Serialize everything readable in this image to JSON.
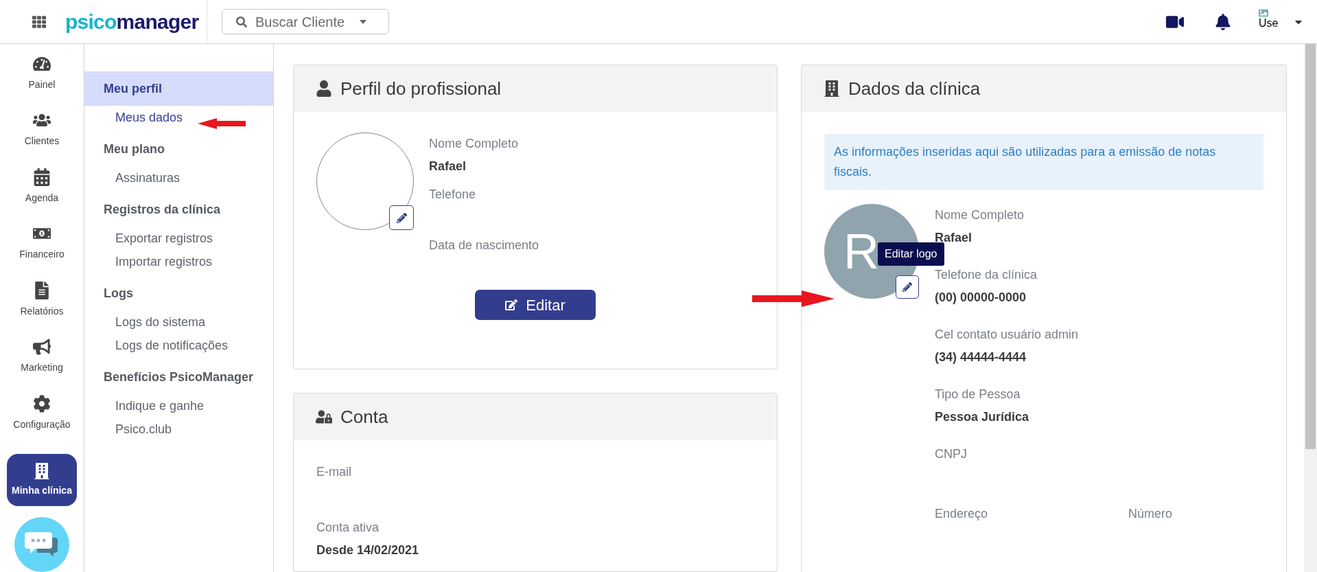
{
  "topbar": {
    "logo_parts": [
      {
        "text": "psico",
        "color": "#12b5c9"
      },
      {
        "text": "manager",
        "color": "#1c1a6b"
      }
    ],
    "search": {
      "placeholder": "Buscar Cliente"
    },
    "avatar_alt": "Use"
  },
  "rail": [
    {
      "label": "Painel",
      "kind": "painel",
      "selected": false
    },
    {
      "label": "Clientes",
      "kind": "clientes",
      "selected": false
    },
    {
      "label": "Agenda",
      "kind": "agenda",
      "selected": false
    },
    {
      "label": "Financeiro",
      "kind": "financeiro",
      "selected": false
    },
    {
      "label": "Relatórios",
      "kind": "relatorios",
      "selected": false
    },
    {
      "label": "Marketing",
      "kind": "marketing",
      "selected": false
    },
    {
      "label": "Configuração",
      "kind": "config",
      "selected": false
    },
    {
      "label": "Minha clínica",
      "kind": "clinica",
      "selected": true
    }
  ],
  "submenu": [
    {
      "heading": "Meu perfil",
      "selected": true,
      "items": [
        {
          "label": "Meus dados",
          "selected": true
        }
      ]
    },
    {
      "heading": "Meu plano",
      "selected": false,
      "items": [
        {
          "label": "Assinaturas",
          "selected": false
        }
      ]
    },
    {
      "heading": "Registros da clínica",
      "selected": false,
      "items": [
        {
          "label": "Exportar registros",
          "selected": false
        },
        {
          "label": "Importar registros",
          "selected": false
        }
      ]
    },
    {
      "heading": "Logs",
      "selected": false,
      "items": [
        {
          "label": "Logs do sistema",
          "selected": false
        },
        {
          "label": "Logs de notificações",
          "selected": false
        }
      ]
    },
    {
      "heading": "Benefícios PsicoManager",
      "selected": false,
      "items": [
        {
          "label": "Indique e ganhe",
          "selected": false
        },
        {
          "label": "Psico.club",
          "selected": false
        }
      ]
    }
  ],
  "profile": {
    "title": "Perfil do profissional",
    "fields": [
      {
        "label": "Nome Completo",
        "value": "Rafael"
      },
      {
        "label": "Telefone"
      },
      {
        "label": "Data de nascimento"
      }
    ],
    "button": "Editar"
  },
  "account": {
    "title": "Conta",
    "fields": [
      {
        "label": "E-mail"
      },
      {
        "label": "Conta ativa",
        "value": "Desde 14/02/2021"
      }
    ]
  },
  "clinic": {
    "title": "Dados da clínica",
    "notice": "As informações inseridas aqui são utilizadas para a emissão de notas fiscais.",
    "logo_letter": "R",
    "tooltip": "Editar logo",
    "rows": [
      [
        {
          "label": "Nome Completo",
          "value": "Rafael"
        }
      ],
      [
        {
          "label": "Telefone da clínica",
          "value": "(00) 00000-0000"
        }
      ],
      [
        {
          "label": "Cel contato usuário admin",
          "value": "(34) 44444-4444"
        }
      ],
      [
        {
          "label": "Tipo de Pessoa",
          "value": "Pessoa Jurídica"
        }
      ],
      [
        {
          "label": "CNPJ"
        }
      ],
      [
        {
          "label": "Endereço"
        },
        {
          "label": "Número"
        }
      ]
    ]
  }
}
